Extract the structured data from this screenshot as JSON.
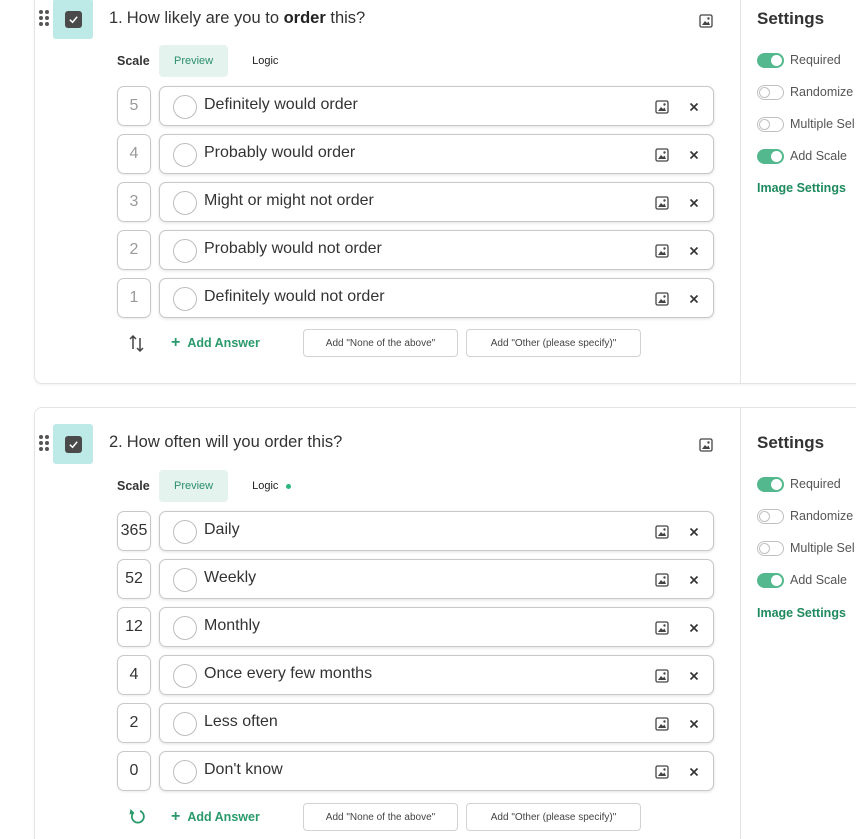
{
  "questions": [
    {
      "number": "1.",
      "title_parts": [
        "How likely are you to ",
        "order",
        " this?"
      ],
      "scale_label": "Scale",
      "tab_preview": "Preview",
      "tab_logic": "Logic",
      "logic_has_rules": false,
      "answers": [
        {
          "scale": "5",
          "text": "Definitely would order"
        },
        {
          "scale": "4",
          "text": "Probably would order"
        },
        {
          "scale": "3",
          "text": "Might or might not order"
        },
        {
          "scale": "2",
          "text": "Probably would not order"
        },
        {
          "scale": "1",
          "text": "Definitely would not order"
        }
      ],
      "footer_icon": "sort-arrows-icon",
      "add_answer": "Add Answer",
      "add_none": "Add \"None of the above\"",
      "add_other": "Add \"Other (please specify)\"",
      "settings": {
        "title": "Settings",
        "toggles": [
          {
            "label": "Required",
            "on": true
          },
          {
            "label": "Randomize",
            "on": false
          },
          {
            "label": "Multiple Sel",
            "on": false
          },
          {
            "label": "Add Scale",
            "on": true
          }
        ],
        "image_settings": "Image Settings"
      }
    },
    {
      "number": "2.",
      "title_parts": [
        "How often will you order this?",
        "",
        ""
      ],
      "scale_label": "Scale",
      "tab_preview": "Preview",
      "tab_logic": "Logic",
      "logic_has_rules": true,
      "answers": [
        {
          "scale": "365",
          "text": "Daily"
        },
        {
          "scale": "52",
          "text": "Weekly"
        },
        {
          "scale": "12",
          "text": "Monthly"
        },
        {
          "scale": "4",
          "text": "Once every few months"
        },
        {
          "scale": "2",
          "text": "Less often"
        },
        {
          "scale": "0",
          "text": "Don't know"
        }
      ],
      "footer_icon": "reset-icon",
      "add_answer": "Add Answer",
      "add_none": "Add \"None of the above\"",
      "add_other": "Add \"Other (please specify)\"",
      "settings": {
        "title": "Settings",
        "toggles": [
          {
            "label": "Required",
            "on": true
          },
          {
            "label": "Randomize",
            "on": false
          },
          {
            "label": "Multiple Sel",
            "on": false
          },
          {
            "label": "Add Scale",
            "on": true
          }
        ],
        "image_settings": "Image Settings"
      }
    }
  ],
  "colors": {
    "accent_green": "#2a9a6c",
    "toggle_on": "#53b88d",
    "checkbox_tile": "#bdeae6"
  }
}
